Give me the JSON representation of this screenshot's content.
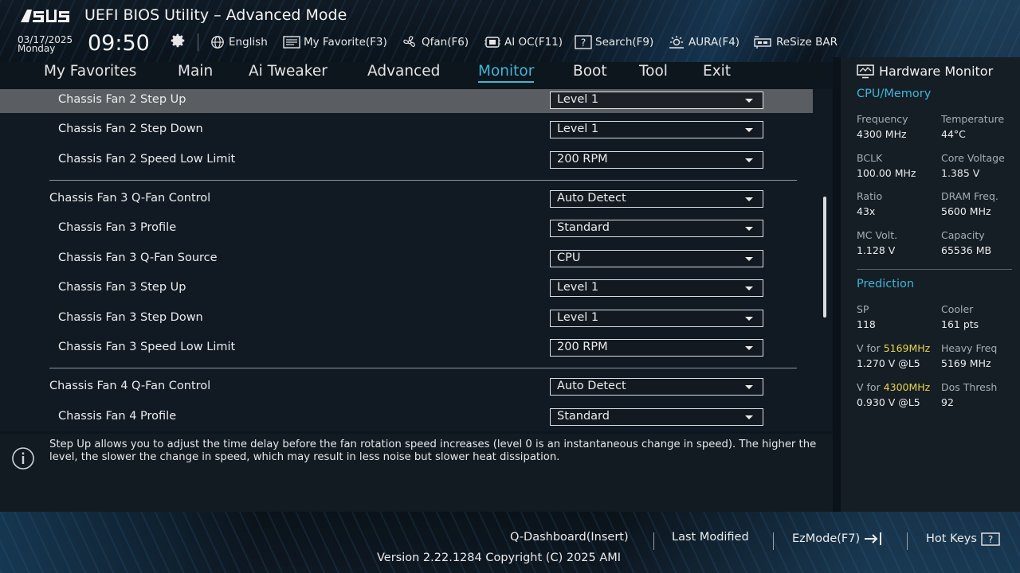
{
  "header": {
    "logo_text": "ASUS",
    "title": "UEFI BIOS Utility – Advanced Mode",
    "date": "03/17/2025",
    "day": "Monday",
    "time": "09:50",
    "toolbar": [
      {
        "label": "English",
        "icon": "globe-icon"
      },
      {
        "label": "My Favorite(F3)",
        "icon": "favorite-icon"
      },
      {
        "label": "Qfan(F6)",
        "icon": "fan-icon"
      },
      {
        "label": "AI OC(F11)",
        "icon": "ai-oc-icon"
      },
      {
        "label": "Search(F9)",
        "icon": "search-icon"
      },
      {
        "label": "AURA(F4)",
        "icon": "aura-icon"
      },
      {
        "label": "ReSize BAR",
        "icon": "resize-bar-icon"
      }
    ]
  },
  "nav": {
    "tabs": [
      "My Favorites",
      "Main",
      "Ai Tweaker",
      "Advanced",
      "Monitor",
      "Boot",
      "Tool",
      "Exit"
    ],
    "active": "Monitor"
  },
  "settings": [
    {
      "label": "Chassis Fan 2 Step Up",
      "value": "Level 1"
    },
    {
      "label": "Chassis Fan 2 Step Down",
      "value": "Level 1"
    },
    {
      "label": "Chassis Fan 2 Speed Low Limit",
      "value": "200 RPM"
    },
    {
      "label": "Chassis Fan 3 Q-Fan Control",
      "value": "Auto Detect"
    },
    {
      "label": "Chassis Fan 3 Profile",
      "value": "Standard"
    },
    {
      "label": "Chassis Fan 3 Q-Fan Source",
      "value": "CPU"
    },
    {
      "label": "Chassis Fan 3 Step Up",
      "value": "Level 1"
    },
    {
      "label": "Chassis Fan 3 Step Down",
      "value": "Level 1"
    },
    {
      "label": "Chassis Fan 3 Speed Low Limit",
      "value": "200 RPM"
    },
    {
      "label": "Chassis Fan 4 Q-Fan Control",
      "value": "Auto Detect"
    },
    {
      "label": "Chassis Fan 4 Profile",
      "value": "Standard"
    }
  ],
  "help": {
    "text": "Step Up allows you to adjust the time delay before the fan rotation speed increases (level 0 is an instantaneous change in speed). The higher the level, the slower the change in speed, which may result in less noise but slower heat dissipation."
  },
  "hw_monitor": {
    "title": "Hardware Monitor",
    "cpu_memory": {
      "title": "CPU/Memory",
      "items": [
        {
          "k": "Frequency",
          "v": "4300 MHz"
        },
        {
          "k": "Temperature",
          "v": "44°C"
        },
        {
          "k": "BCLK",
          "v": "100.00 MHz"
        },
        {
          "k": "Core Voltage",
          "v": "1.385 V"
        },
        {
          "k": "Ratio",
          "v": "43x"
        },
        {
          "k": "DRAM Freq.",
          "v": "5600 MHz"
        },
        {
          "k": "MC Volt.",
          "v": "1.128 V"
        },
        {
          "k": "Capacity",
          "v": "65536 MB"
        }
      ]
    },
    "prediction": {
      "title": "Prediction",
      "sp_k": "SP",
      "sp_v": "118",
      "cooler_k": "Cooler",
      "cooler_v": "161 pts",
      "vfor_prefix": "V for ",
      "vfor1_freq": "5169MHz",
      "vfor1_v": "1.270 V @L5",
      "heavy_k": "Heavy Freq",
      "heavy_v": "5169 MHz",
      "vfor2_freq": "4300MHz",
      "vfor2_v": "0.930 V @L5",
      "dos_k": "Dos Thresh",
      "dos_v": "92"
    }
  },
  "footer": {
    "q_dashboard": "Q-Dashboard(Insert)",
    "last_modified": "Last Modified",
    "ezmode": "EzMode(F7)",
    "hotkeys": "Hot Keys",
    "hotkeys_glyph": "?",
    "version": "Version 2.22.1284 Copyright (C) 2025 AMI"
  },
  "colors": {
    "accent": "#3fb6d8",
    "highlight": "#e9d54a",
    "selected_row": "#5a5e63"
  }
}
